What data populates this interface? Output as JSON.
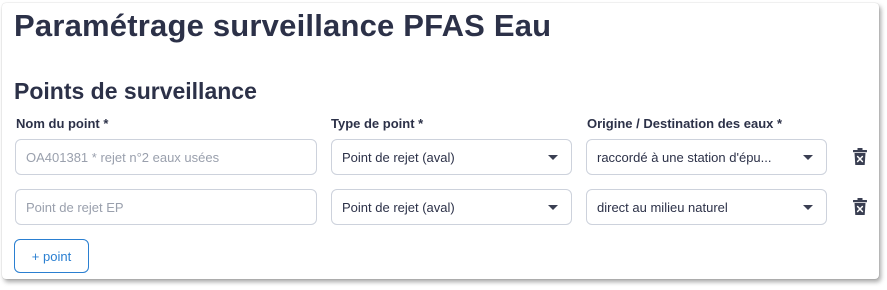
{
  "header": {
    "title": "Paramétrage surveillance PFAS Eau"
  },
  "section": {
    "title": "Points de surveillance",
    "columns": {
      "name": "Nom du point *",
      "type": "Type de point *",
      "origin": "Origine / Destination des eaux *"
    }
  },
  "rows": [
    {
      "name_placeholder": "OA401381 * rejet n°2 eaux usées",
      "type": "Point de rejet (aval)",
      "origin": "raccordé à une station d'épu..."
    },
    {
      "name_placeholder": "Point de rejet EP",
      "type": "Point de rejet (aval)",
      "origin": "direct au milieu naturel"
    }
  ],
  "actions": {
    "add_point_label": "+ point"
  },
  "icons": {
    "delete": "trash-icon",
    "dropdown": "chevron-down-icon"
  },
  "colors": {
    "text": "#2c3148",
    "accent": "#2a7fd1",
    "border": "#cdd2dc",
    "placeholder": "#9aa0ad"
  }
}
